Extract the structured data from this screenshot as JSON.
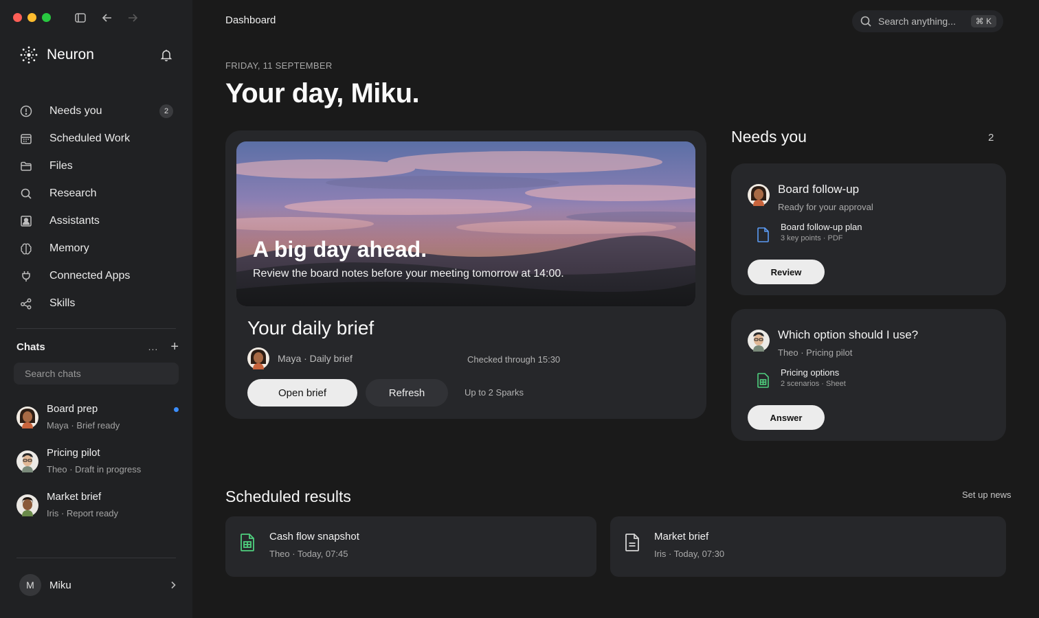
{
  "window": {
    "title": "Dashboard"
  },
  "brand": {
    "name": "Neuron"
  },
  "nav": {
    "items": [
      {
        "label": "Needs you",
        "icon": "alert-circle-icon",
        "badge": "2"
      },
      {
        "label": "Scheduled Work",
        "icon": "calendar-icon"
      },
      {
        "label": "Files",
        "icon": "folder-icon"
      },
      {
        "label": "Research",
        "icon": "search-icon"
      },
      {
        "label": "Assistants",
        "icon": "person-card-icon"
      },
      {
        "label": "Memory",
        "icon": "brain-icon"
      },
      {
        "label": "Connected Apps",
        "icon": "plug-icon"
      },
      {
        "label": "Skills",
        "icon": "share-nodes-icon"
      }
    ]
  },
  "chats": {
    "title": "Chats",
    "more": "...",
    "add": "+",
    "search_placeholder": "Search chats",
    "items": [
      {
        "title": "Board prep",
        "subtitle": "Maya · Brief ready",
        "unread": true
      },
      {
        "title": "Pricing pilot",
        "subtitle": "Theo · Draft in progress"
      },
      {
        "title": "Market brief",
        "subtitle": "Iris · Report ready"
      }
    ]
  },
  "user": {
    "initial": "M",
    "name": "Miku"
  },
  "search": {
    "placeholder": "Search anything...",
    "shortcut": "⌘ K"
  },
  "header": {
    "date": "FRIDAY, 11 SEPTEMBER",
    "greeting": "Your day, Miku."
  },
  "brief": {
    "hero_title": "A big day ahead.",
    "hero_subtitle": "Review the board notes before your meeting tomorrow at 14:00.",
    "title": "Your daily brief",
    "byline": "Maya · Daily brief",
    "checked": "Checked through 15:30",
    "open_label": "Open brief",
    "refresh_label": "Refresh",
    "sparks": "Up to 2 Sparks"
  },
  "needs_you": {
    "title": "Needs you",
    "count": "2",
    "cards": [
      {
        "title": "Board follow-up",
        "subtitle": "Ready for your approval",
        "file_name": "Board follow-up plan",
        "file_meta": "3 key points · PDF",
        "file_icon": "document-icon",
        "file_color": "#5b9cf5",
        "button": "Review"
      },
      {
        "title": "Which option should I use?",
        "subtitle": "Theo · Pricing pilot",
        "file_name": "Pricing options",
        "file_meta": "2 scenarios · Sheet",
        "file_icon": "spreadsheet-icon",
        "file_color": "#4fcf7e",
        "button": "Answer"
      }
    ]
  },
  "scheduled": {
    "title": "Scheduled results",
    "setup_link": "Set up news",
    "items": [
      {
        "title": "Cash flow snapshot",
        "subtitle": "Theo · Today, 07:45",
        "icon": "spreadsheet-icon",
        "color": "#4fcf7e"
      },
      {
        "title": "Market brief",
        "subtitle": "Iris · Today, 07:30",
        "icon": "document-lines-icon",
        "color": "#d6d6d6"
      }
    ]
  },
  "colors": {
    "accent_dot": "#3b8eff",
    "background": "#1a1a1a",
    "sidebar": "#202123",
    "card": "#26272a"
  }
}
